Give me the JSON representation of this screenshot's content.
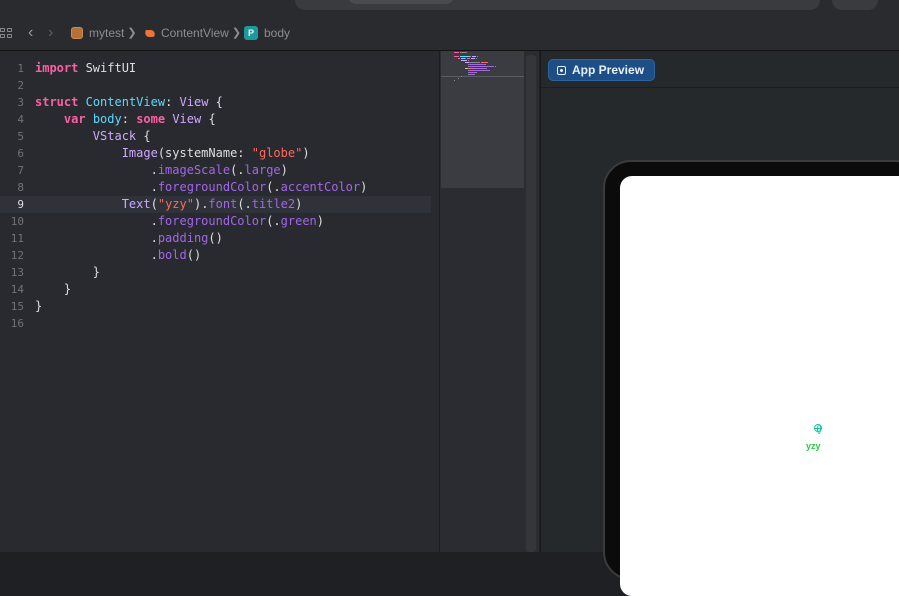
{
  "breadcrumbs": [
    {
      "label": "mytest",
      "icon": "project-icon"
    },
    {
      "label": "ContentView",
      "icon": "swift-file-icon"
    },
    {
      "label": "body",
      "icon": "property-icon",
      "badge": "P"
    }
  ],
  "breadcrumb_separator": "❯",
  "editor": {
    "active_line": 9,
    "line_numbers": [
      "1",
      "2",
      "3",
      "4",
      "5",
      "6",
      "7",
      "8",
      "9",
      "10",
      "11",
      "12",
      "13",
      "14",
      "15",
      "16"
    ],
    "lines": [
      [
        {
          "t": "import",
          "c": "kw"
        },
        {
          "t": " SwiftUI",
          "c": "pl"
        }
      ],
      [],
      [
        {
          "t": "struct",
          "c": "kw"
        },
        {
          "t": " ",
          "c": "pl"
        },
        {
          "t": "ContentView",
          "c": "tyd"
        },
        {
          "t": ": ",
          "c": "pl"
        },
        {
          "t": "View",
          "c": "ty"
        },
        {
          "t": " {",
          "c": "pl"
        }
      ],
      [
        {
          "t": "    ",
          "c": "pl"
        },
        {
          "t": "var",
          "c": "kw"
        },
        {
          "t": " ",
          "c": "pl"
        },
        {
          "t": "body",
          "c": "tyd"
        },
        {
          "t": ": ",
          "c": "pl"
        },
        {
          "t": "some",
          "c": "kw"
        },
        {
          "t": " ",
          "c": "pl"
        },
        {
          "t": "View",
          "c": "ty"
        },
        {
          "t": " {",
          "c": "pl"
        }
      ],
      [
        {
          "t": "        ",
          "c": "pl"
        },
        {
          "t": "VStack",
          "c": "ty"
        },
        {
          "t": " {",
          "c": "pl"
        }
      ],
      [
        {
          "t": "            ",
          "c": "pl"
        },
        {
          "t": "Image",
          "c": "ty"
        },
        {
          "t": "(systemName: ",
          "c": "pl"
        },
        {
          "t": "\"globe\"",
          "c": "str"
        },
        {
          "t": ")",
          "c": "pl"
        }
      ],
      [
        {
          "t": "                .",
          "c": "pl"
        },
        {
          "t": "imageScale",
          "c": "fn"
        },
        {
          "t": "(.",
          "c": "pl"
        },
        {
          "t": "large",
          "c": "fn"
        },
        {
          "t": ")",
          "c": "pl"
        }
      ],
      [
        {
          "t": "                .",
          "c": "pl"
        },
        {
          "t": "foregroundColor",
          "c": "fn"
        },
        {
          "t": "(.",
          "c": "pl"
        },
        {
          "t": "accentColor",
          "c": "fn"
        },
        {
          "t": ")",
          "c": "pl"
        }
      ],
      [
        {
          "t": "            ",
          "c": "pl"
        },
        {
          "t": "Text",
          "c": "ty"
        },
        {
          "t": "(",
          "c": "pl"
        },
        {
          "t": "\"yzy\"",
          "c": "str"
        },
        {
          "t": ").",
          "c": "pl"
        },
        {
          "t": "font",
          "c": "fn"
        },
        {
          "t": "(.",
          "c": "pl"
        },
        {
          "t": "title2",
          "c": "fn"
        },
        {
          "t": ")",
          "c": "pl"
        }
      ],
      [
        {
          "t": "                .",
          "c": "pl"
        },
        {
          "t": "foregroundColor",
          "c": "fn"
        },
        {
          "t": "(.",
          "c": "pl"
        },
        {
          "t": "green",
          "c": "fn"
        },
        {
          "t": ")",
          "c": "pl"
        }
      ],
      [
        {
          "t": "                .",
          "c": "pl"
        },
        {
          "t": "padding",
          "c": "fn"
        },
        {
          "t": "()",
          "c": "pl"
        }
      ],
      [
        {
          "t": "                .",
          "c": "pl"
        },
        {
          "t": "bold",
          "c": "fn"
        },
        {
          "t": "()",
          "c": "pl"
        }
      ],
      [
        {
          "t": "        }",
          "c": "pl"
        }
      ],
      [
        {
          "t": "    }",
          "c": "pl"
        }
      ],
      [
        {
          "t": "}",
          "c": "pl"
        }
      ],
      []
    ]
  },
  "canvas": {
    "preview_mode_label": "App Preview",
    "preview_text": "yzy",
    "preview_icon": "globe-icon"
  },
  "colors": {
    "keyword": "#fc5fa3",
    "type": "#d0a8ff",
    "declaration": "#5dd8ff",
    "string": "#fc6a5d",
    "method": "#a167e6",
    "preview_text": "#2ec74a",
    "preview_icon": "#17c7a0",
    "accent_button": "#1d4f86"
  }
}
